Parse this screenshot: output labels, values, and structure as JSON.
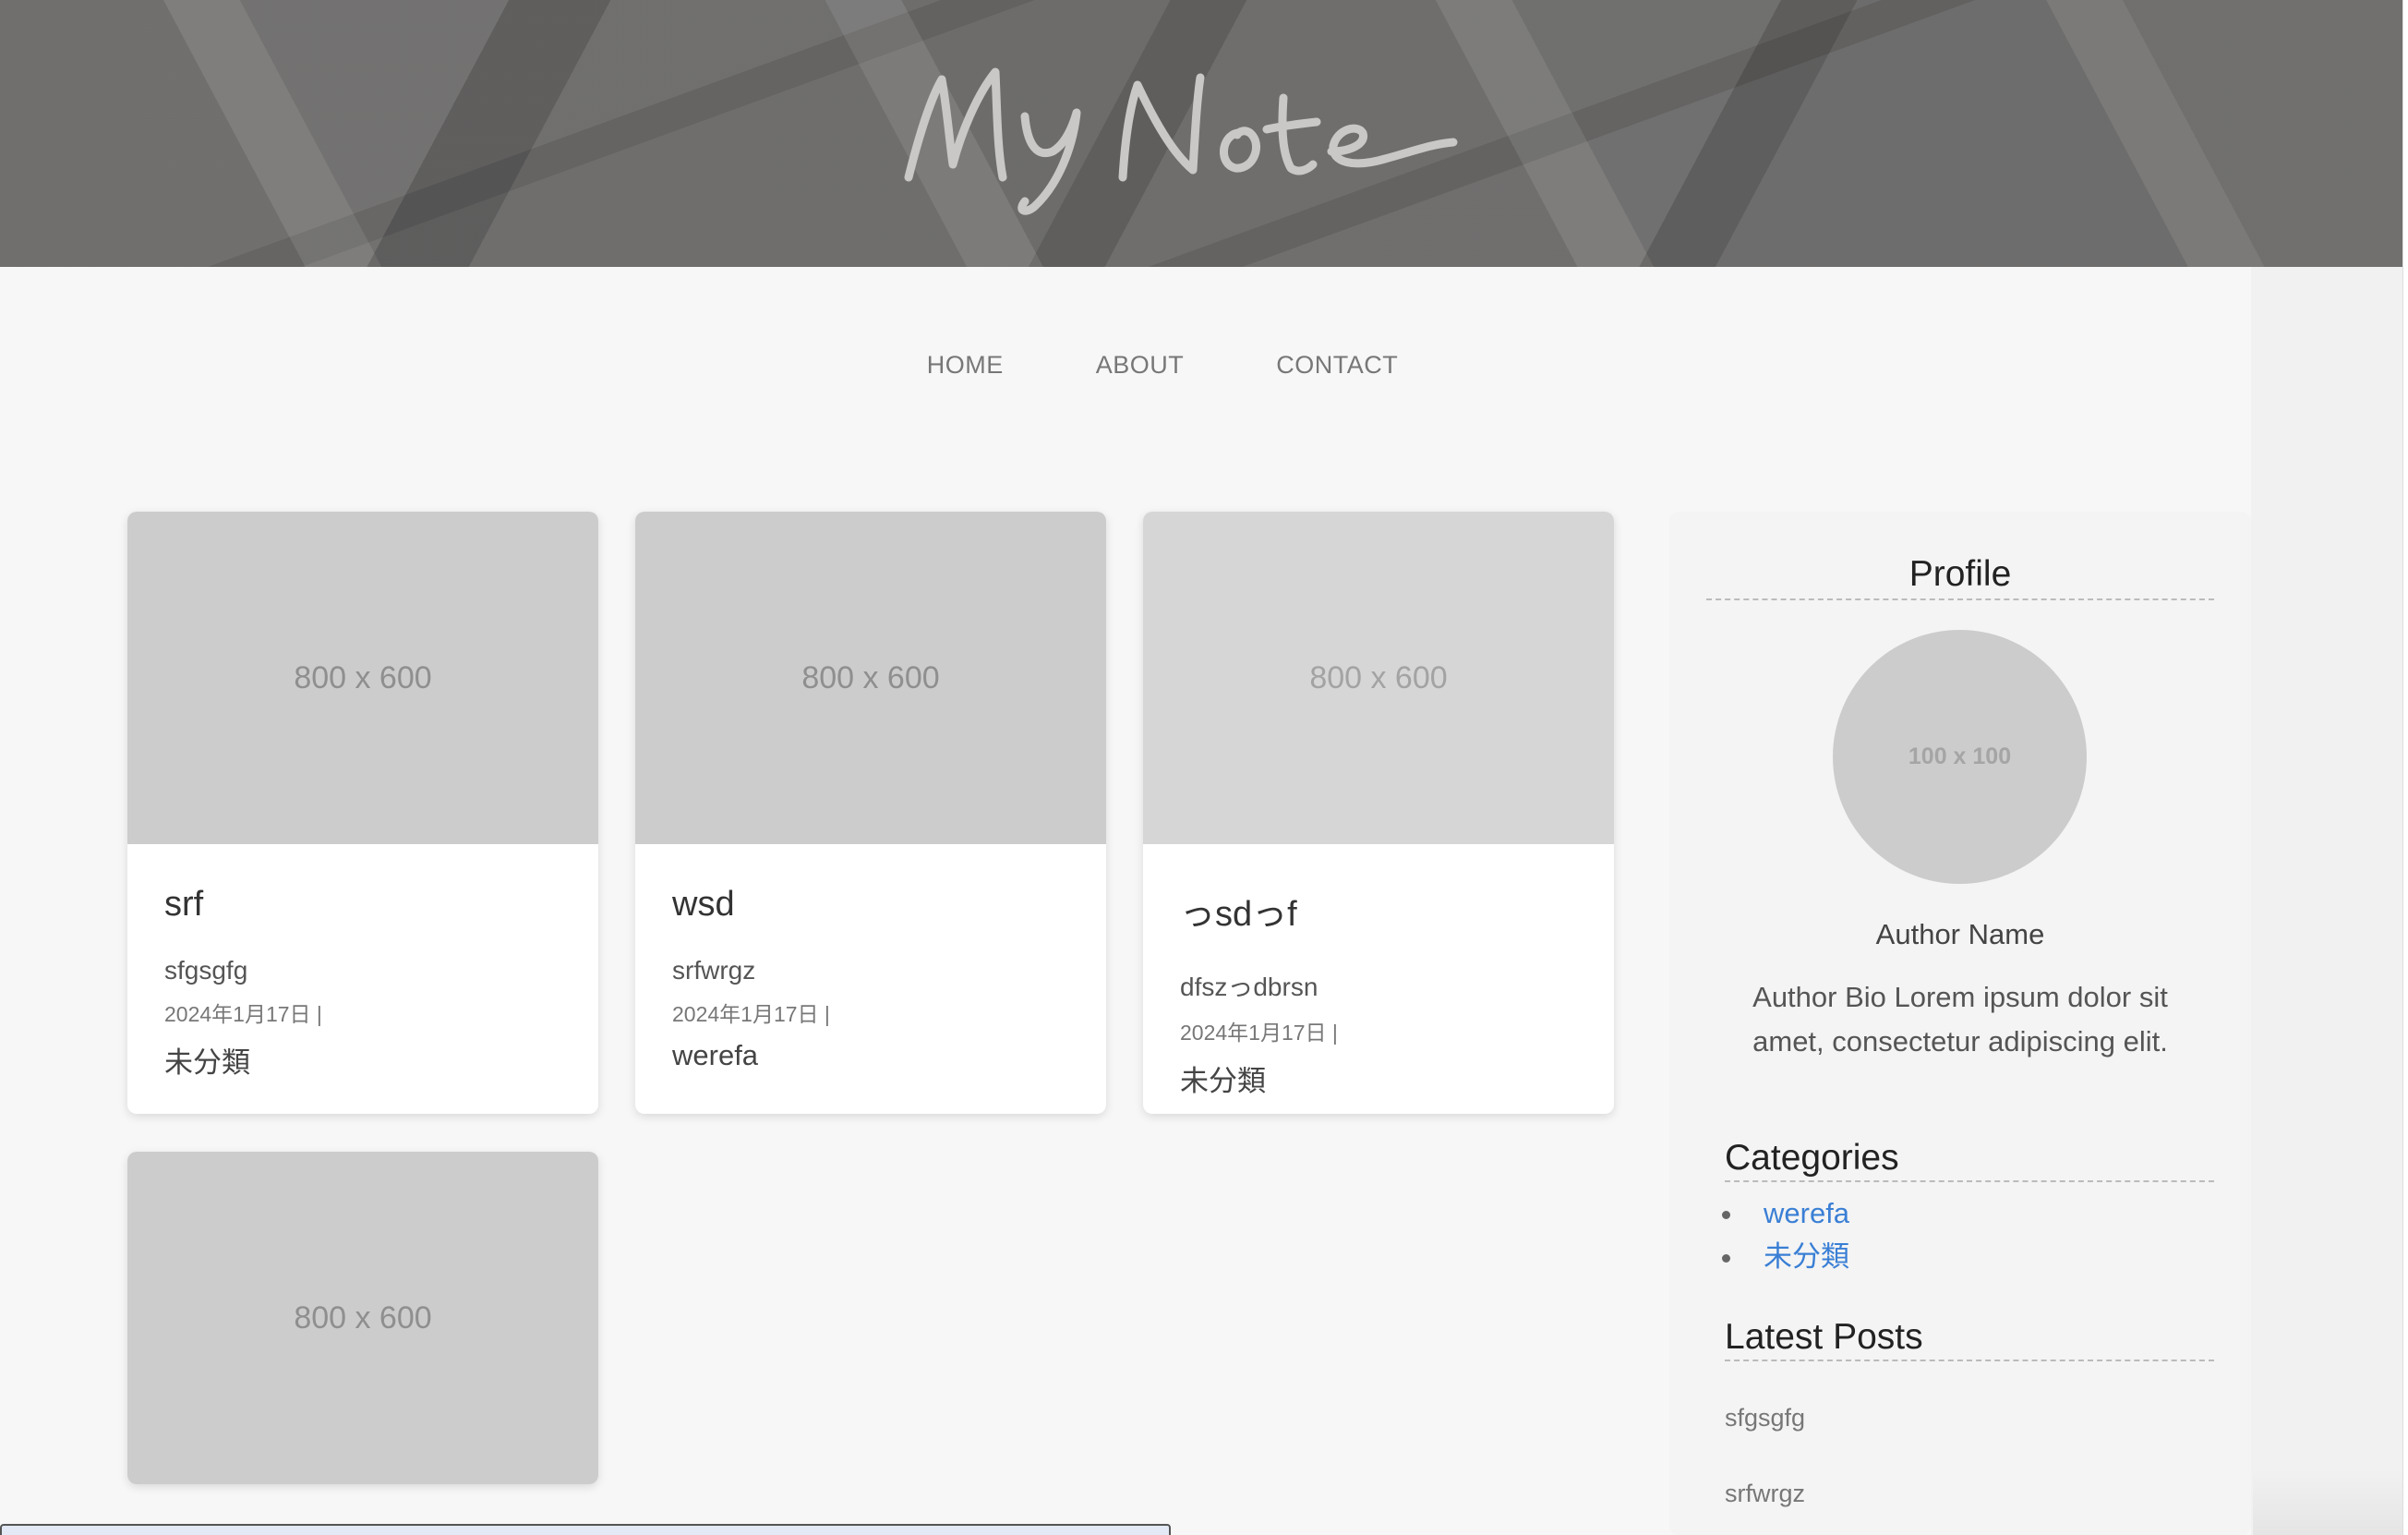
{
  "header": {
    "logo_text": "My Note"
  },
  "nav": {
    "items": [
      "HOME",
      "ABOUT",
      "CONTACT"
    ]
  },
  "posts": [
    {
      "thumb": "800 x 600",
      "title": "srf",
      "excerpt": "sfgsgfg",
      "date": "2024年1月17日 |",
      "category": "未分類"
    },
    {
      "thumb": "800 x 600",
      "title": "wsd",
      "excerpt": "srfwrgz",
      "date": "2024年1月17日 |",
      "category": "werefa"
    },
    {
      "thumb": "800 x 600",
      "title": "っsdっf",
      "excerpt": "dfszっdbrsn",
      "date": "2024年1月17日 |",
      "category": "未分類"
    },
    {
      "thumb": "800 x 600"
    }
  ],
  "sidebar": {
    "profile_title": "Profile",
    "avatar_text": "100 x 100",
    "author_name": "Author Name",
    "author_bio": "Author Bio Lorem ipsum dolor sit amet, consectetur adipiscing elit.",
    "categories_title": "Categories",
    "categories": [
      "werefa",
      "未分類"
    ],
    "latest_title": "Latest Posts",
    "latest_posts": [
      "sfgsgfg",
      "srfwrgz"
    ]
  },
  "colors": {
    "link": "#3a7fd5",
    "header_bg": "#6a6968",
    "page_bg": "#f7f7f7"
  }
}
